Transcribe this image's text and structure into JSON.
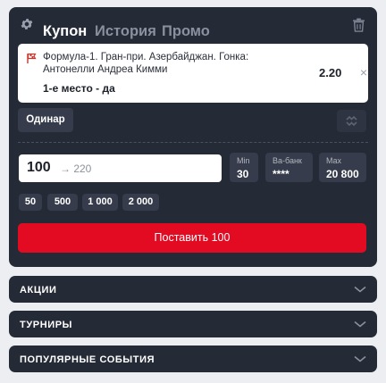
{
  "coupon": {
    "tabs": [
      {
        "label": "Купон",
        "active": true
      },
      {
        "label": "История",
        "active": false
      },
      {
        "label": "Промо",
        "active": false
      }
    ],
    "bet": {
      "event": "Формула-1. Гран-при. Азербайджан. Гонка: Антонелли Андреа Кимми",
      "outcome": "1-е место - да",
      "odds": "2.20",
      "remove_glyph": "×"
    },
    "bet_type": "Одинар",
    "stake": {
      "value": "100",
      "potential_win_hint": "→ 220"
    },
    "limits": [
      {
        "label": "Min",
        "value": "30"
      },
      {
        "label": "Ва-банк",
        "value": "****"
      },
      {
        "label": "Max",
        "value": "20 800"
      }
    ],
    "quick_amounts": [
      "50",
      "500",
      "1 000",
      "2 000"
    ],
    "place_button": "Поставить 100"
  },
  "sections": [
    {
      "title": "АКЦИИ"
    },
    {
      "title": "ТУРНИРЫ"
    },
    {
      "title": "ПОПУЛЯРНЫЕ СОБЫТИЯ"
    }
  ],
  "icons": {
    "settings": "gear-icon",
    "delete": "trash-icon",
    "sport": "checkered-flag-icon",
    "remove": "close-icon",
    "expand": "expand-arrows-icon",
    "section_toggle": "chevron-down-icon"
  },
  "colors": {
    "panel": "#252a37",
    "accent_button": "#e30b22",
    "chip": "#363c4b"
  }
}
